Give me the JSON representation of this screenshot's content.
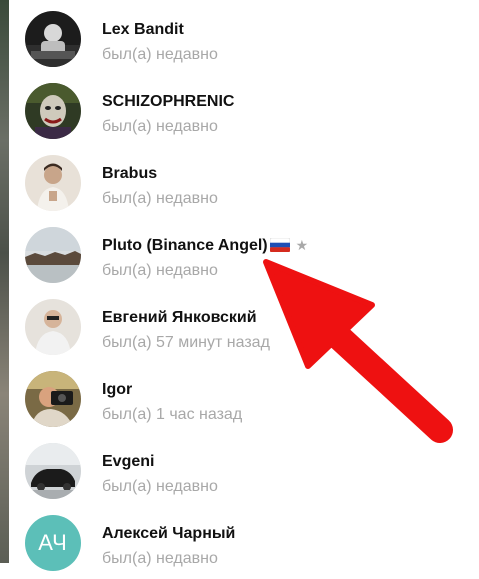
{
  "contacts": [
    {
      "name": "Lex Bandit",
      "status": "был(а) недавно"
    },
    {
      "name": "SCHIZOPHRENIC",
      "status": "был(а) недавно"
    },
    {
      "name": "Brabus",
      "status": "был(а) недавно"
    },
    {
      "name": "Pluto (Binance Angel)",
      "status": "был(а) недавно",
      "badge_icon": "russia-flag-icon",
      "extra_icon": "star-icon",
      "star": "★"
    },
    {
      "name": "Евгений Янковский",
      "status": "был(а) 57 минут назад"
    },
    {
      "name": "Igor",
      "status": "был(а) 1 час назад"
    },
    {
      "name": "Evgeni",
      "status": "был(а) недавно"
    },
    {
      "name": "Алексей Чарный",
      "status": "был(а) недавно",
      "initials": "АЧ",
      "avatar_color": "#5cbfb8"
    }
  ],
  "colors": {
    "name": "#111111",
    "status": "#a8a8a8",
    "arrow": "#ee1111"
  },
  "annotation": {
    "icon": "red-arrow-icon"
  }
}
